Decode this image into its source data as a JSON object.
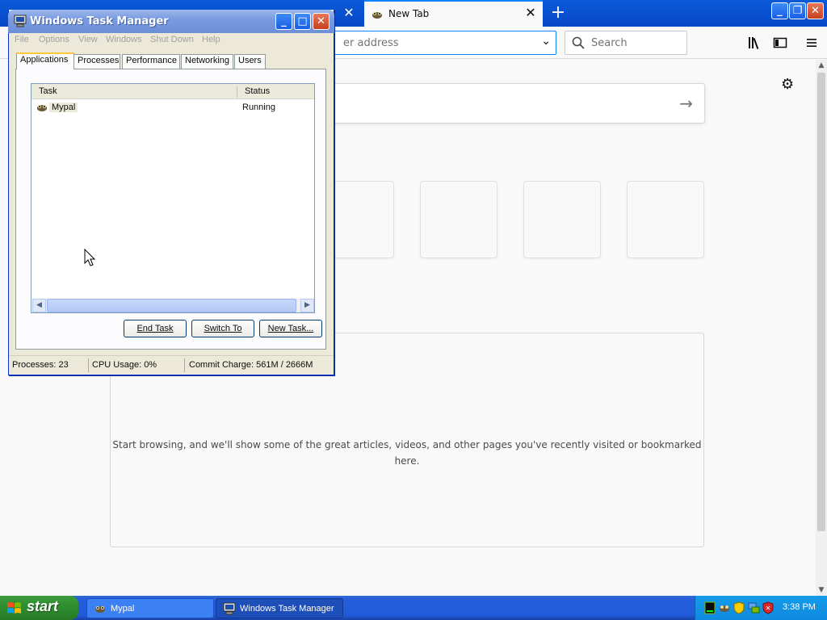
{
  "browser": {
    "tab_active_label": "New Tab",
    "tab_close_glyph": "✕",
    "new_tab_glyph": "+",
    "url_placeholder_partial": "er address",
    "search_placeholder": "Search",
    "highlights_message": "Start browsing, and we'll show some of the great articles, videos, and other pages you've recently visited or bookmarked here.",
    "window_controls": [
      "minimize",
      "restore",
      "close"
    ],
    "toolbar_icons": [
      "library-icon",
      "sidebar-icon",
      "menu-icon"
    ]
  },
  "taskmgr": {
    "title": "Windows Task Manager",
    "menu": [
      "File",
      "Options",
      "View",
      "Windows",
      "Shut Down",
      "Help"
    ],
    "tabs": [
      "Applications",
      "Processes",
      "Performance",
      "Networking",
      "Users"
    ],
    "active_tab": "Applications",
    "columns": {
      "task": "Task",
      "status": "Status"
    },
    "rows": [
      {
        "task": "Mypal",
        "status": "Running"
      }
    ],
    "buttons": {
      "end_task": "End Task",
      "switch_to": "Switch To",
      "new_task": "New Task..."
    },
    "status": {
      "processes": "Processes: 23",
      "cpu": "CPU Usage: 0%",
      "commit": "Commit Charge: 561M / 2666M"
    }
  },
  "taskbar": {
    "start_label": "start",
    "tasks": [
      {
        "label": "Mypal",
        "active": false
      },
      {
        "label": "Windows Task Manager",
        "active": true
      }
    ],
    "clock": "3:38 PM"
  },
  "colors": {
    "xp_blue": "#245ddb",
    "start_green": "#2f8f2f",
    "firefox_accent": "#0a84ff"
  }
}
